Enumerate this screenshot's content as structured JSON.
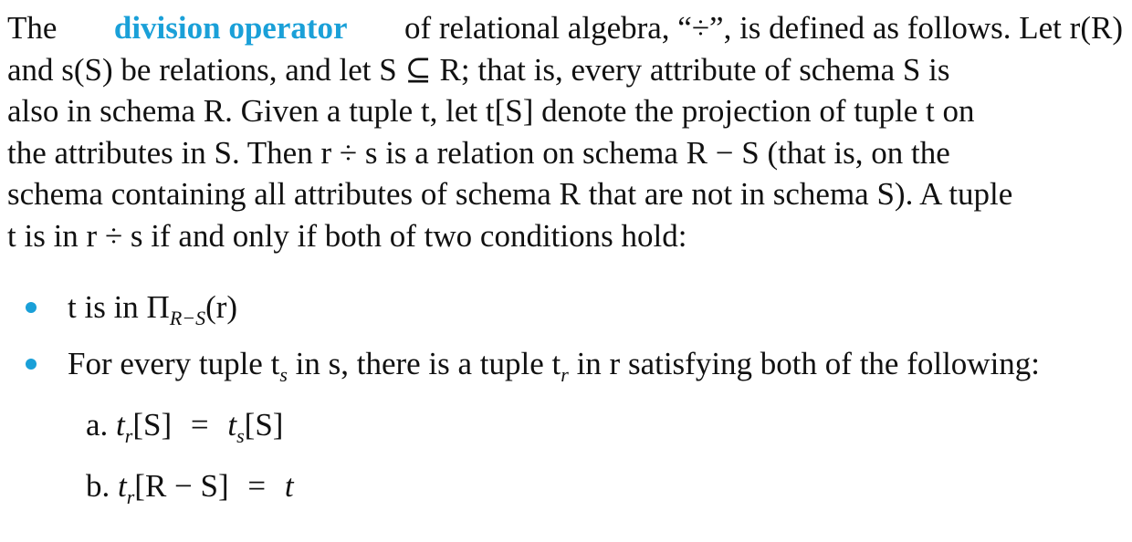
{
  "paragraph": {
    "line1": {
      "start": "The",
      "term": "division operator",
      "rest": "of relational algebra, “÷”, is defined as follows. Let r(R)"
    },
    "line2": "and s(S) be relations, and let S ⊆ R; that is, every attribute of schema S is",
    "line3": "also in schema R. Given a tuple t, let t[S] denote the projection of tuple t on",
    "line4": "the attributes in S. Then r ÷ s is a relation on schema R − S (that is, on the",
    "line5": "schema containing all attributes of schema R that are not in schema S). A tuple",
    "line6": "t is in r ÷ s if and only if both of two conditions hold:"
  },
  "bullets": [
    {
      "text_prefix": "t is in Π",
      "subscript": "R−S",
      "text_suffix": "(r)"
    },
    {
      "text": "For every tuple t",
      "sub1": "s",
      "mid": " in s, there is a tuple t",
      "sub2": "r",
      "end": " in r satisfying both of the following:"
    }
  ],
  "conditions": [
    {
      "label": "a.",
      "lhs": "t",
      "lhs_sub": "r",
      "lhs_tail": "[S]",
      "op": "=",
      "rhs": "t",
      "rhs_sub": "s",
      "rhs_tail": "[S]"
    },
    {
      "label": "b.",
      "lhs": "t",
      "lhs_sub": "r",
      "lhs_tail": "[R − S]",
      "op": "=",
      "rhs": "t"
    }
  ],
  "colors": {
    "accent": "#1aa0d8",
    "text": "#111111"
  }
}
